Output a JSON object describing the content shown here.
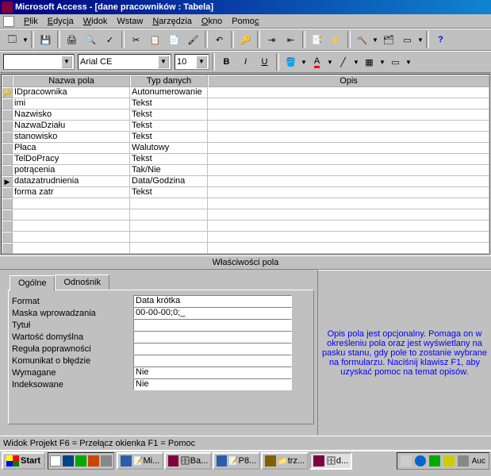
{
  "titlebar": {
    "text": "Microsoft Access - [dane pracowników : Tabela]"
  },
  "menu": {
    "file": "Plik",
    "edit": "Edycja",
    "view": "Widok",
    "insert": "Wstaw",
    "tools": "Narzędzia",
    "window": "Okno",
    "help": "Pomoc"
  },
  "format_toolbar": {
    "font": "Arial CE",
    "size": "10"
  },
  "grid": {
    "headers": {
      "name": "Nazwa pola",
      "type": "Typ danych",
      "desc": "Opis"
    },
    "rows": [
      {
        "marker": "🔑",
        "name": "IDpracownika",
        "type": "Autonumerowanie",
        "desc": ""
      },
      {
        "marker": "",
        "name": "imi",
        "type": "Tekst",
        "desc": ""
      },
      {
        "marker": "",
        "name": "Nazwisko",
        "type": "Tekst",
        "desc": ""
      },
      {
        "marker": "",
        "name": "NazwaDziału",
        "type": "Tekst",
        "desc": ""
      },
      {
        "marker": "",
        "name": "stanowisko",
        "type": "Tekst",
        "desc": ""
      },
      {
        "marker": "",
        "name": "Płaca",
        "type": "Walutowy",
        "desc": ""
      },
      {
        "marker": "",
        "name": "TelDoPracy",
        "type": "Tekst",
        "desc": ""
      },
      {
        "marker": "",
        "name": "potrącenia",
        "type": "Tak/Nie",
        "desc": ""
      },
      {
        "marker": "▶",
        "name": "datazatrudnienia",
        "type": "Data/Godzina",
        "desc": ""
      },
      {
        "marker": "",
        "name": "forma zatr",
        "type": "Tekst",
        "desc": ""
      }
    ]
  },
  "props_title": "Właściwości pola",
  "tabs": {
    "general": "Ogólne",
    "lookup": "Odnośnik"
  },
  "props": {
    "format_l": "Format",
    "format_v": "Data krótka",
    "mask_l": "Maska wprowadzania",
    "mask_v": "00-00-00;0;_",
    "title_l": "Tytuł",
    "title_v": "",
    "default_l": "Wartość domyślna",
    "default_v": "",
    "rule_l": "Reguła poprawności",
    "rule_v": "",
    "msg_l": "Komunikat o błędzie",
    "msg_v": "",
    "req_l": "Wymagane",
    "req_v": "Nie",
    "idx_l": "Indeksowane",
    "idx_v": "Nie"
  },
  "help_text": "Opis pola jest opcjonalny. Pomaga on w określeniu pola oraz jest wyświetlany na pasku stanu, gdy pole to zostanie wybrane na formularzu. Naciśnij klawisz F1, aby uzyskać pomoc na temat opisów.",
  "status": "Widok Projekt  F6 = Przełącz okienka  F1 = Pomoc",
  "taskbar": {
    "start": "Start",
    "t1": "Mi...",
    "t2": "Ba...",
    "t3": "P8...",
    "t4": "trz...",
    "t5": "d...",
    "tray_last": "Auc"
  }
}
